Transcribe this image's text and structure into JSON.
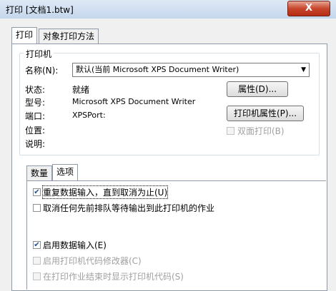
{
  "window": {
    "title": "打印 [文档1.btw]",
    "close_label": "X"
  },
  "tabs": [
    "打印",
    "对象打印方法"
  ],
  "printer": {
    "group_label": "打印机",
    "name_label": "名称(N):",
    "name_value": "默认(当前 Microsoft XPS Document Writer)",
    "status_label": "状态:",
    "status_value": "就绪",
    "model_label": "型号:",
    "model_value": "Microsoft XPS Document Writer",
    "port_label": "端口:",
    "port_value": "XPSPort:",
    "location_label": "位置:",
    "comment_label": "说明:",
    "attributes_button": "属性(D)...",
    "printer_attributes_button": "打印机属性(P)...",
    "duplex_label": "双面打印(B)"
  },
  "subtabs": [
    "数量",
    "选项"
  ],
  "options": [
    {
      "label": "重复数据输入，直到取消为止(U)",
      "checked": true,
      "enabled": true
    },
    {
      "label": "取消任何先前排队等待输出到此打印机的作业",
      "checked": false,
      "enabled": true
    },
    {
      "label": "启用数据输入(E)",
      "checked": true,
      "enabled": true
    },
    {
      "label": "启用打印机代码修改器(C)",
      "checked": false,
      "enabled": false
    },
    {
      "label": "在打印作业结束时显示打印机代码(S)",
      "checked": false,
      "enabled": false
    }
  ]
}
